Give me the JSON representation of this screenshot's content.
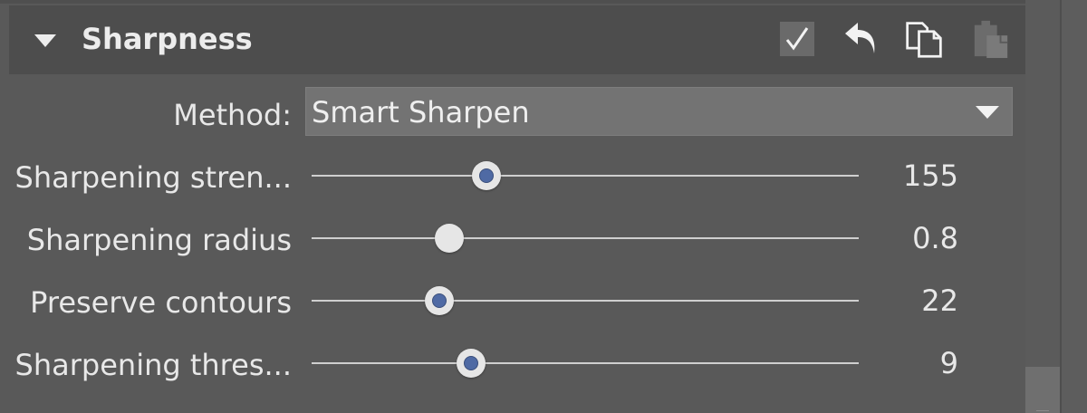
{
  "panel": {
    "title": "Sharpness",
    "collapse_icon": "triangle-down-icon",
    "header_buttons": [
      {
        "name": "enable-checkbox",
        "icon": "checkmark-icon",
        "checked": true
      },
      {
        "name": "reset-button",
        "icon": "undo-arrow-icon"
      },
      {
        "name": "copy-settings-button",
        "icon": "copy-icon"
      },
      {
        "name": "paste-settings-button",
        "icon": "paste-icon",
        "disabled": true
      }
    ]
  },
  "method": {
    "label": "Method:",
    "selected": "Smart Sharpen",
    "dropdown_icon": "caret-down-icon"
  },
  "sliders": [
    {
      "label": "Sharpening stren...",
      "value": "155",
      "position_fraction": 0.319,
      "thumb_style": "dot"
    },
    {
      "label": "Sharpening radius",
      "value": "0.8",
      "position_fraction": 0.252,
      "thumb_style": "plain"
    },
    {
      "label": "Preserve contours",
      "value": "22",
      "position_fraction": 0.233,
      "thumb_style": "dot"
    },
    {
      "label": "Sharpening thres...",
      "value": "9",
      "position_fraction": 0.291,
      "thumb_style": "dot"
    }
  ],
  "colors": {
    "panel_bg": "#595959",
    "header_bg": "#4d4d4d",
    "dropdown_bg": "#737373",
    "thumb": "#e6e6e6",
    "thumb_dot": "#4f6aa4",
    "text": "#e8e8e8"
  }
}
